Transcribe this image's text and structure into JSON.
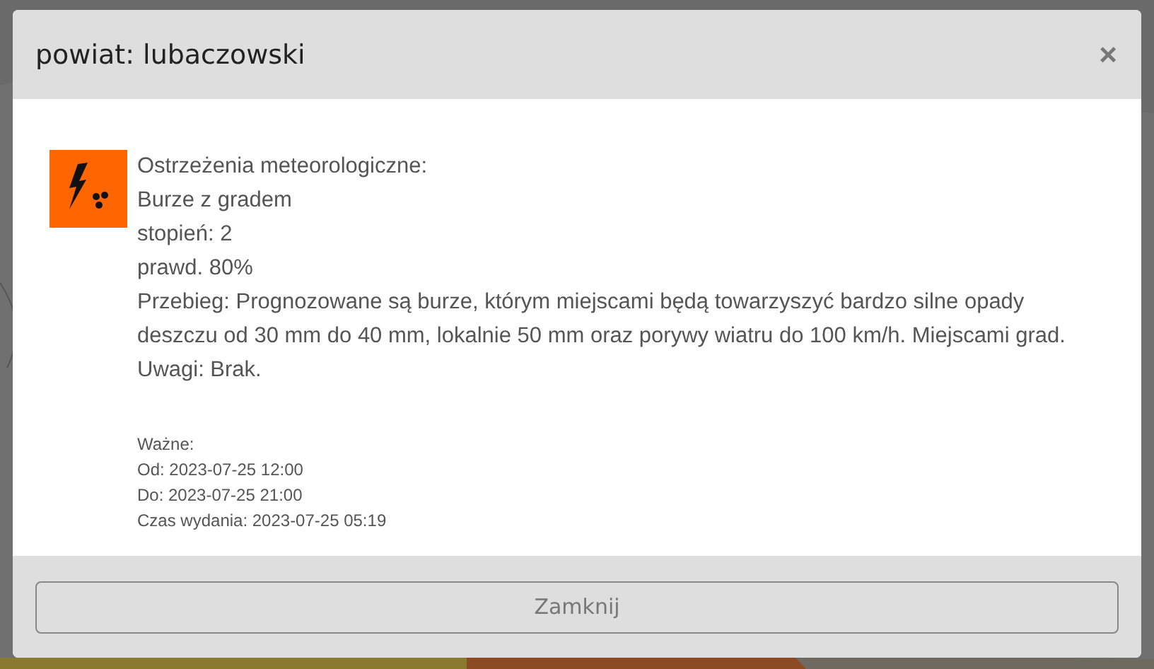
{
  "dialog": {
    "title": "powiat: lubaczowski",
    "close": "×",
    "warning": {
      "lines": [
        "Ostrzeżenia meteorologiczne:",
        "Burze z gradem",
        "stopień: 2",
        "prawd. 80%",
        "Przebieg: Prognozowane są burze, którym miejscami będą towarzyszyć bardzo silne opady deszczu od 30 mm do 40 mm, lokalnie 50 mm oraz porywy wiatru do 100 km/h. Miejscami grad.",
        "Uwagi: Brak."
      ],
      "validity": [
        "Ważne:",
        "Od: 2023-07-25 12:00",
        "Do: 2023-07-25 21:00",
        "Czas wydania: 2023-07-25 05:19"
      ]
    },
    "button": "Zamknij"
  }
}
